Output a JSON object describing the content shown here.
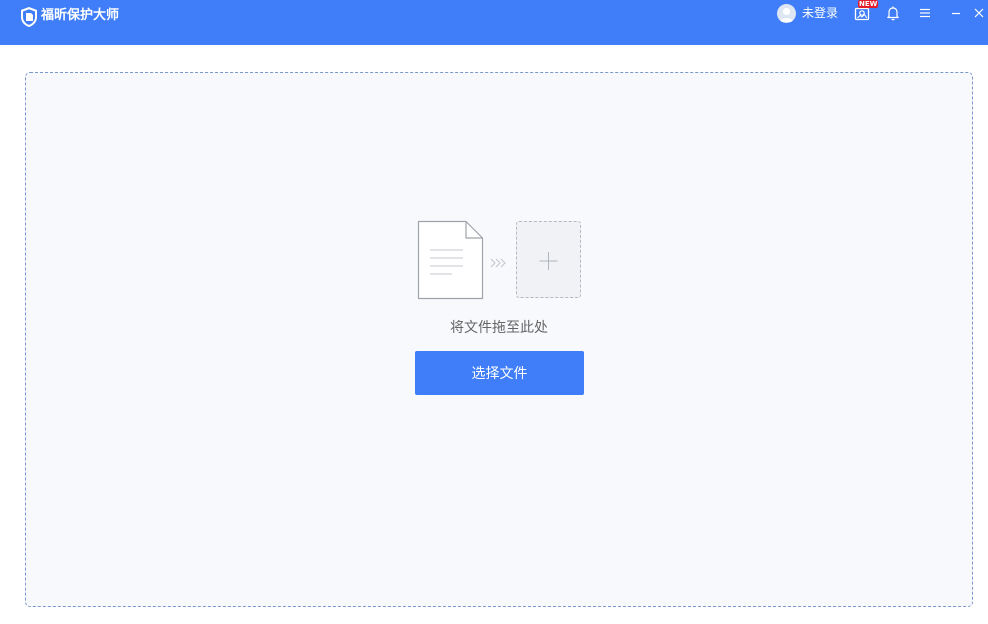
{
  "app": {
    "title": "福昕保护大师",
    "logo_icon": "shield-icon",
    "accent_color": "#3f7ef8"
  },
  "titlebar": {
    "user_label": "未登录",
    "user_icon": "avatar-icon",
    "buttons": [
      {
        "name": "gallery-icon",
        "badge": "NEW"
      },
      {
        "name": "bell-icon"
      },
      {
        "name": "menu-icon"
      },
      {
        "name": "minimize-icon"
      },
      {
        "name": "close-icon"
      }
    ]
  },
  "main": {
    "drop_hint": "将文件拖至此处",
    "select_button_label": "选择文件",
    "icons": [
      "document-icon",
      "double-chevron-right-icon",
      "plus-icon"
    ]
  }
}
